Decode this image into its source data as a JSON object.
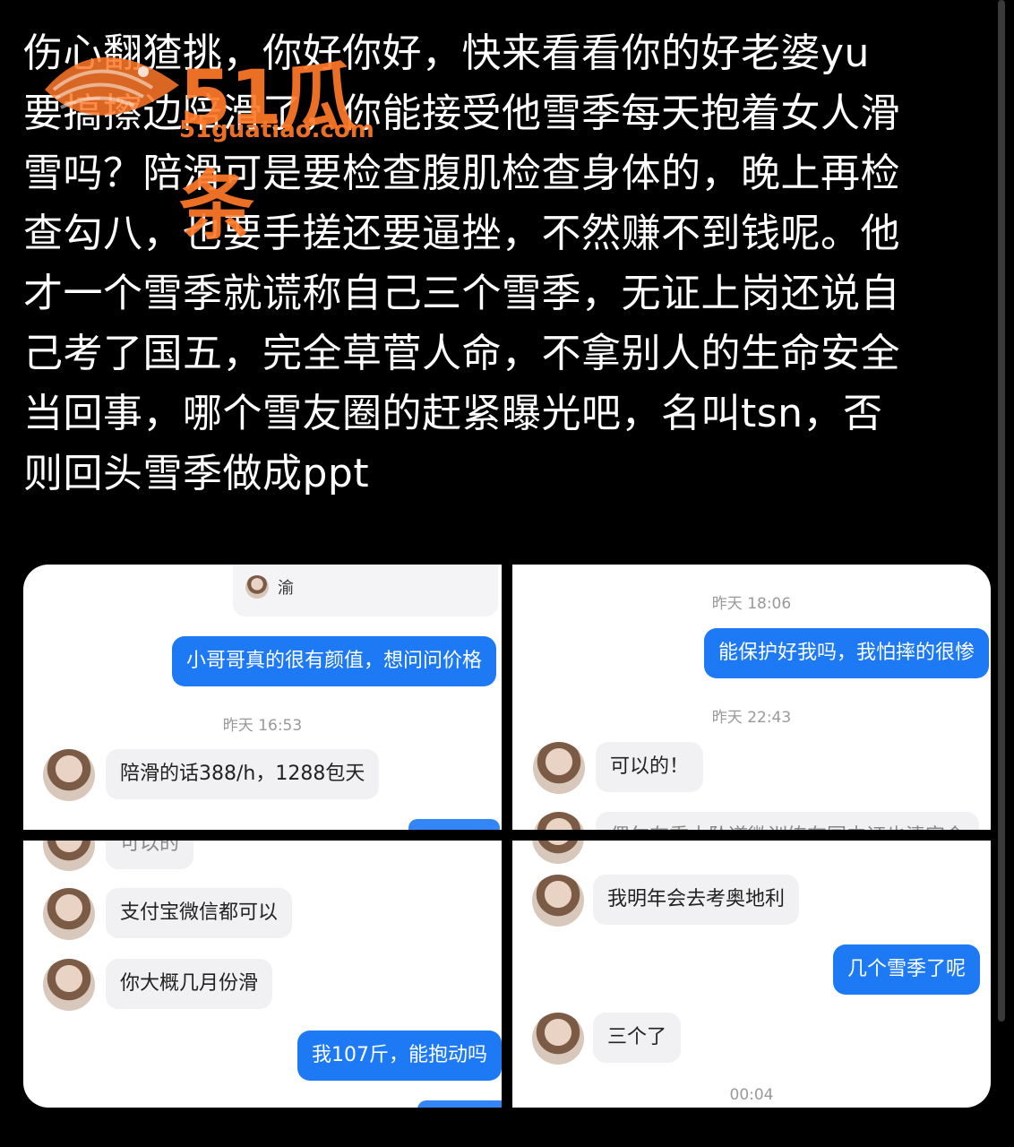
{
  "post": {
    "lines": [
      "伤心翻猹挑，你好你好，快来看看你的好老婆yu",
      "要搞擦边陪滑了，你能接受他雪季每天抱着女人滑",
      "雪吗？陪滑可是要检查腹肌检查身体的，晚上再检",
      "查勾八，也要手搓还要逼挫，不然赚不到钱呢。他",
      "才一个雪季就谎称自己三个雪季，无证上岗还说自",
      "己考了国五，完全草菅人命，不拿别人的生命安全",
      "当回事，哪个雪友圈的赶紧曝光吧，名叫tsn，否",
      "则回头雪季做成ppt"
    ]
  },
  "watermark": {
    "logo_text": "51瓜条",
    "url": "51guatiao.com"
  },
  "panel1": {
    "card_name": "渝",
    "out_msg": "小哥哥真的很有颜值，想问问价格",
    "timestamp": "昨天 16:53",
    "in_msg": "陪滑的话388/h，1288包天"
  },
  "panel2": {
    "timestamp1": "昨天 18:06",
    "out_msg": "能保护好我吗，我怕摔的很惨",
    "timestamp2": "昨天 22:43",
    "in_msg": "可以的！",
    "cut_msg": "偶尔在重大坠道微训练在国内证也清定会"
  },
  "panel3": {
    "cut_msg": "可以的",
    "in_msg1": "支付宝微信都可以",
    "in_msg2": "你大概几月份滑",
    "out_msg": "我107斤，能抱动吗"
  },
  "panel4": {
    "in_msg1": "我明年会去考奥地利",
    "out_msg": "几个雪季了呢",
    "in_msg2": "三个了",
    "timestamp": "00:04"
  }
}
